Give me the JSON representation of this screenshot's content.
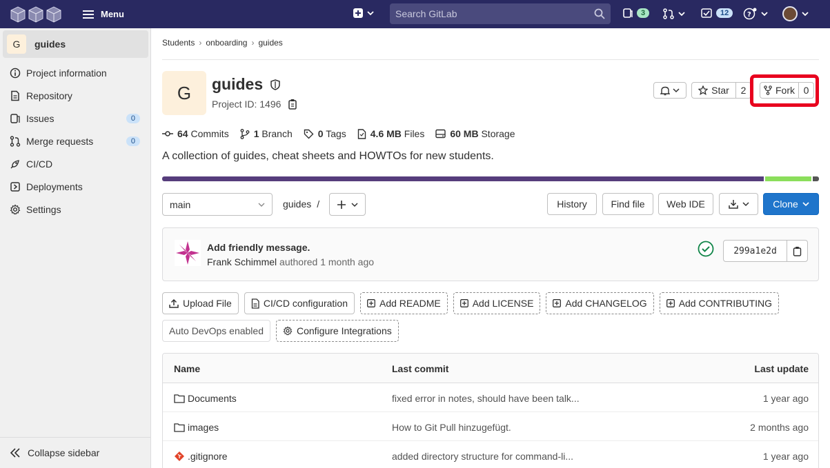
{
  "topbar": {
    "menu_label": "Menu",
    "search_placeholder": "Search GitLab",
    "issues_count": "3",
    "todos_count": "12"
  },
  "sidebar": {
    "project_initial": "G",
    "project_name": "guides",
    "items": [
      {
        "label": "Project information",
        "icon": "info-icon"
      },
      {
        "label": "Repository",
        "icon": "document-icon"
      },
      {
        "label": "Issues",
        "icon": "issues-icon",
        "badge": "0"
      },
      {
        "label": "Merge requests",
        "icon": "merge-request-icon",
        "badge": "0"
      },
      {
        "label": "CI/CD",
        "icon": "rocket-icon"
      },
      {
        "label": "Deployments",
        "icon": "deployments-icon"
      },
      {
        "label": "Settings",
        "icon": "gear-icon"
      }
    ],
    "collapse_label": "Collapse sidebar"
  },
  "breadcrumb": [
    "Students",
    "onboarding",
    "guides"
  ],
  "project": {
    "initial": "G",
    "title": "guides",
    "project_id_text": "Project ID: 1496",
    "star_label": "Star",
    "star_count": "2",
    "fork_label": "Fork",
    "fork_count": "0",
    "stats": [
      {
        "value": "64",
        "label": "Commits",
        "icon": "commit-icon"
      },
      {
        "value": "1",
        "label": "Branch",
        "icon": "branch-icon"
      },
      {
        "value": "0",
        "label": "Tags",
        "icon": "tag-icon"
      },
      {
        "value": "4.6 MB",
        "label": "Files",
        "icon": "file-icon"
      },
      {
        "value": "60 MB",
        "label": "Storage",
        "icon": "storage-icon"
      }
    ],
    "description": "A collection of guides, cheat sheets and HOWTOs for new students.",
    "language_colors": [
      "#563d7c",
      "#8bde5b",
      "#555555"
    ],
    "language_shares": [
      92.0,
      7.0,
      1.0
    ]
  },
  "toolbar": {
    "branch": "main",
    "path": "guides",
    "path_sep": "/",
    "history": "History",
    "find_file": "Find file",
    "web_ide": "Web IDE",
    "clone": "Clone"
  },
  "commit": {
    "title": "Add friendly message.",
    "author": "Frank Schimmel",
    "meta": "authored 1 month ago",
    "sha": "299a1e2d"
  },
  "quick_actions": {
    "row1": [
      "Upload File",
      "CI/CD configuration",
      "Add README",
      "Add LICENSE",
      "Add CHANGELOG",
      "Add CONTRIBUTING"
    ],
    "row2": [
      "Auto DevOps enabled",
      "Configure Integrations"
    ]
  },
  "files": {
    "headers": {
      "name": "Name",
      "commit": "Last commit",
      "update": "Last update"
    },
    "rows": [
      {
        "name": "Documents",
        "type": "folder",
        "commit": "fixed error in notes, should have been talk...",
        "update": "1 year ago"
      },
      {
        "name": "images",
        "type": "folder",
        "commit": "How to Git Pull hinzugefügt.",
        "update": "2 months ago"
      },
      {
        "name": ".gitignore",
        "type": "git-file",
        "commit": "added directory structure for command-li...",
        "update": "1 year ago"
      }
    ]
  }
}
